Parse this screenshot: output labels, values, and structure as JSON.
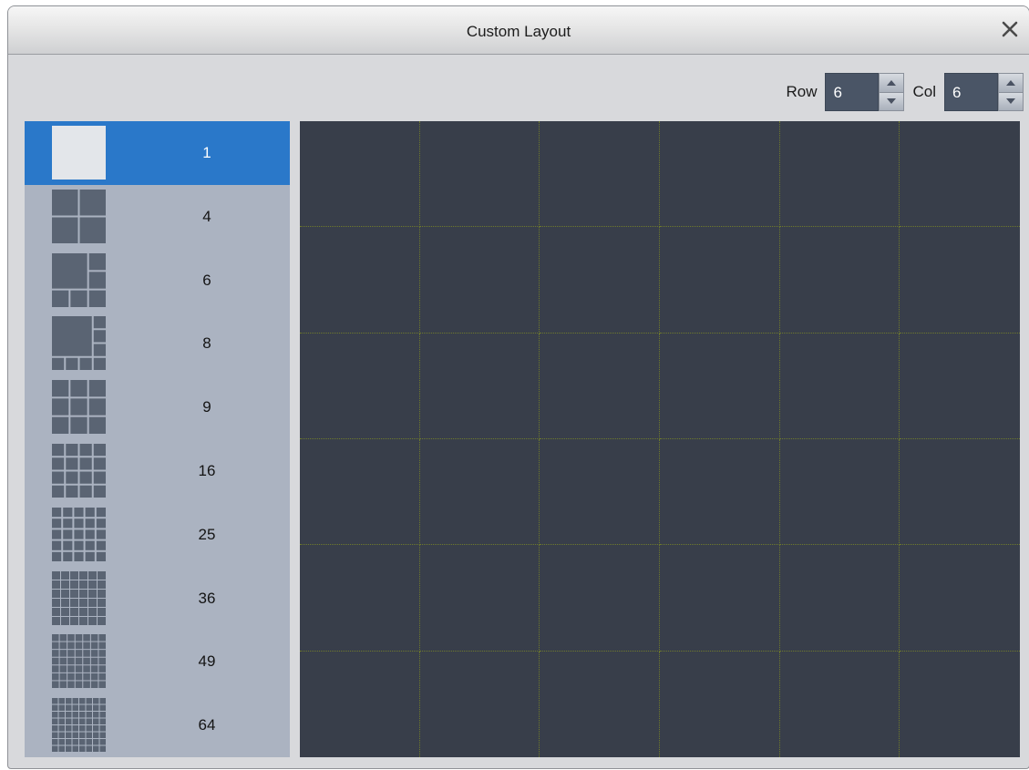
{
  "window": {
    "title": "Custom Layout"
  },
  "toolbar": {
    "row_label": "Row",
    "row_value": "6",
    "col_label": "Col",
    "col_value": "6"
  },
  "layouts": [
    {
      "label": "1",
      "icon": "layout-1-icon",
      "selected": true
    },
    {
      "label": "4",
      "icon": "layout-4-icon",
      "selected": false
    },
    {
      "label": "6",
      "icon": "layout-6-icon",
      "selected": false
    },
    {
      "label": "8",
      "icon": "layout-8-icon",
      "selected": false
    },
    {
      "label": "9",
      "icon": "layout-9-icon",
      "selected": false
    },
    {
      "label": "16",
      "icon": "layout-16-icon",
      "selected": false
    },
    {
      "label": "25",
      "icon": "layout-25-icon",
      "selected": false
    },
    {
      "label": "36",
      "icon": "layout-36-icon",
      "selected": false
    },
    {
      "label": "49",
      "icon": "layout-49-icon",
      "selected": false
    },
    {
      "label": "64",
      "icon": "layout-64-icon",
      "selected": false
    }
  ],
  "colors": {
    "selected": "#2a78c9",
    "canvas": "#383e4a",
    "grid_line": "#6f7a2c",
    "sidebar": "#abb3c1",
    "icon_fill": "#5a6473",
    "icon_selected_fill": "#e3e6ea"
  }
}
